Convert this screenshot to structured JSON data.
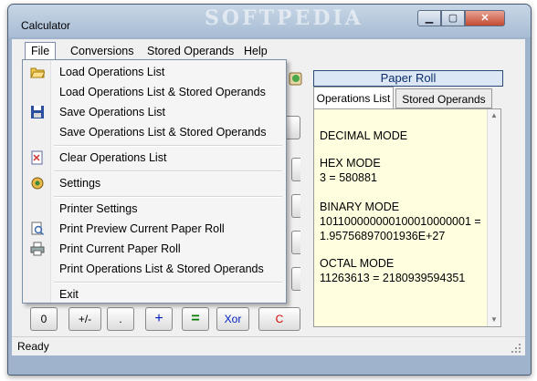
{
  "window": {
    "title": "Calculator",
    "watermark": "SOFTPEDIA"
  },
  "menubar": [
    {
      "label": "File"
    },
    {
      "label": "Conversions"
    },
    {
      "label": "Stored Operands"
    },
    {
      "label": "Help"
    }
  ],
  "file_menu": {
    "items": [
      {
        "label": "Load Operations List",
        "icon": "folder-open-icon"
      },
      {
        "label": "Load Operations List & Stored Operands",
        "icon": ""
      },
      {
        "label": "Save Operations List",
        "icon": "floppy-disk-icon"
      },
      {
        "label": "Save Operations List & Stored Operands",
        "icon": ""
      },
      {
        "label": "Clear Operations List",
        "icon": "clear-list-icon"
      },
      {
        "label": "Settings",
        "icon": "settings-icon"
      },
      {
        "label": "Printer Settings",
        "icon": ""
      },
      {
        "label": "Print Preview Current Paper Roll",
        "icon": "print-preview-icon"
      },
      {
        "label": "Print Current Paper Roll",
        "icon": "printer-icon"
      },
      {
        "label": "Print Operations List & Stored Operands",
        "icon": ""
      },
      {
        "label": "Exit",
        "icon": ""
      }
    ]
  },
  "paper_roll": {
    "title": "Paper Roll",
    "tabs": [
      {
        "label": "Operations List"
      },
      {
        "label": "Stored Operands"
      }
    ],
    "lines": [
      "DECIMAL MODE",
      "",
      "HEX MODE",
      "3 = 580881",
      "",
      "BINARY MODE",
      "101100000000100010000001 =",
      "1.95756897001936E+27",
      "",
      "OCTAL MODE",
      "11263613 = 2180939594351"
    ]
  },
  "keypad": {
    "zero": "0",
    "sign": "+/-",
    "decimal": ".",
    "plus": "+",
    "equals": "=",
    "xor": "Xor",
    "clear": "C"
  },
  "status": {
    "text": "Ready"
  },
  "colors": {
    "accent": "#0b2e6b",
    "clear": "#d00000",
    "equals": "#007a00",
    "plus": "#0020c0",
    "xor": "#0020c0",
    "paper": "#ffffe0"
  }
}
